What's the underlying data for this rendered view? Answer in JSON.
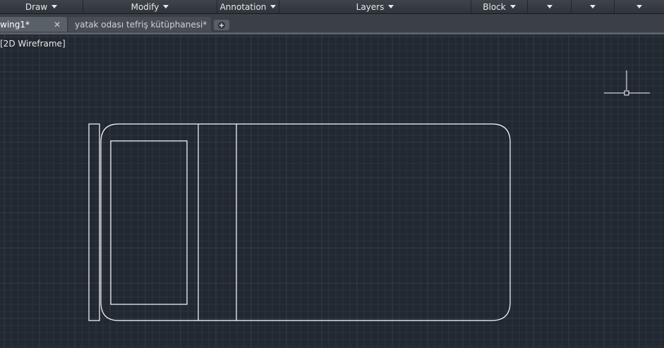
{
  "ribbon": {
    "panels": [
      {
        "label": "Draw"
      },
      {
        "label": "Modify"
      },
      {
        "label": "Annotation"
      },
      {
        "label": "Layers"
      },
      {
        "label": "Block"
      },
      {
        "label": ""
      },
      {
        "label": ""
      },
      {
        "label": ""
      }
    ]
  },
  "tabs": {
    "active_label": "wing1*",
    "inactive_label": "yatak odası tefriş kütüphanesi*",
    "close_glyph": "✕",
    "new_tab_glyph": "+"
  },
  "viewport": {
    "view_label": "[2D Wireframe]",
    "background": "#212830",
    "grid_color": "#2c3440",
    "grid_major_color": "#343d4a",
    "line_color": "#ffffff"
  },
  "icons": {
    "panel_expand": "triangle-down",
    "crosshair": "crosshair-cursor"
  }
}
